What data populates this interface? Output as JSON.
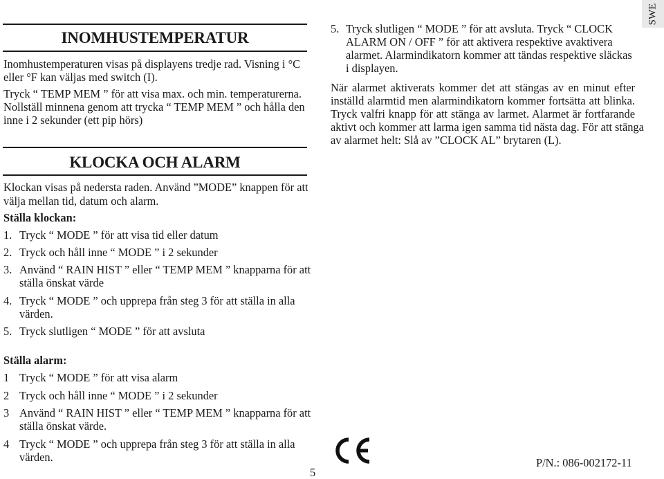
{
  "tab": {
    "language": "SWE"
  },
  "indoor": {
    "heading": "INOMHUSTEMPERATUR",
    "para1": [
      "Inomhustemperaturen visas på displayens tredje rad. Visning i °C",
      "eller °F kan väljas med switch (I)."
    ],
    "para2": [
      "Tryck “ TEMP MEM ” för att visa max. och min. temperaturerna.",
      "Nollställ minnena genom att trycka “ TEMP MEM ” och hålla den",
      "inne i 2 sekunder (ett pip hörs)"
    ]
  },
  "clock": {
    "heading": "KLOCKA OCH ALARM",
    "intro": [
      "Klockan visas på nedersta raden. Använd ”MODE” knappen för att",
      "välja mellan tid, datum och alarm."
    ],
    "set_clock_title": "Ställa klockan:",
    "set_clock_steps": [
      {
        "num": "1.",
        "lines": [
          "Tryck “ MODE ” för att visa tid eller datum"
        ]
      },
      {
        "num": "2.",
        "lines": [
          "Tryck och håll inne “ MODE ” i 2 sekunder"
        ]
      },
      {
        "num": "3.",
        "lines": [
          "Använd “ RAIN HIST ” eller “ TEMP MEM ” knapparna för att",
          "ställa  önskat  värde"
        ]
      },
      {
        "num": "4.",
        "lines": [
          "Tryck “  MODE ” och upprepa från steg 3 för att ställa in alla",
          "värden."
        ]
      },
      {
        "num": "5.",
        "lines": [
          "Tryck slutligen “  MODE ” för att avsluta"
        ]
      }
    ],
    "set_alarm_title": "Ställa alarm:",
    "set_alarm_steps": [
      {
        "num": "1",
        "lines": [
          "Tryck “  MODE ” för att visa alarm"
        ]
      },
      {
        "num": "2",
        "lines": [
          "Tryck och håll inne “  MODE ” i 2 sekunder"
        ]
      },
      {
        "num": "3",
        "lines": [
          "Använd “ RAIN HIST ” eller “  TEMP MEM ” knapparna för att",
          "ställa  önskat  värde."
        ]
      },
      {
        "num": "4",
        "lines": [
          "Tryck “  MODE ” och upprepa från steg 3 för att ställa in alla",
          "värden."
        ]
      },
      {
        "num": "5.",
        "lines": [
          "Tryck slutligen “  MODE ”  för att avsluta. Tryck “  CLOCK",
          "ALARM  ON / OFF ” för att aktivera respektive avaktivera",
          "alarmet. Alarmindikatorn kommer att tändas respektive släckas",
          "i  displayen."
        ]
      }
    ],
    "alarm_note": [
      "När alarmet aktiverats kommer det att stängas av en minut efter",
      "inställd alarmtid men alarmindikatorn kommer fortsätta att blinka.",
      "Tryck valfri knapp för att stänga av larmet. Alarmet är fortfarande",
      "aktivt och kommer att larma igen samma tid nästa dag. För att stänga",
      "av alarmet helt: Slå av ”CLOCK AL” brytaren (L)."
    ]
  },
  "footer": {
    "page_number": "5",
    "certification_mark": "CE",
    "part_number": "P/N.: 086-002172-11"
  }
}
